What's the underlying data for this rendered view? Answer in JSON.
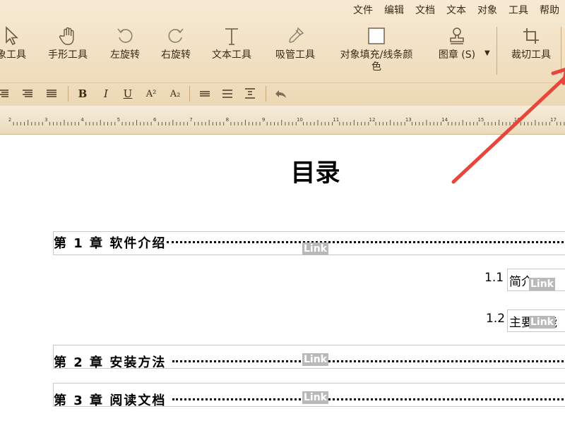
{
  "menu": [
    "文件",
    "编辑",
    "文档",
    "文本",
    "对象",
    "工具",
    "帮助"
  ],
  "tools": {
    "select": "象工具",
    "hand": "手形工具",
    "rotate_left": "左旋转",
    "rotate_right": "右旋转",
    "text": "文本工具",
    "eyedropper": "吸管工具",
    "fill_line1": "对象填充/线条颜",
    "fill_line2": "色",
    "stamp": "图章 (S)",
    "crop": "裁切工具"
  },
  "format": {
    "bold": "B",
    "italic": "I",
    "underline": "U",
    "superscript": "A²",
    "subscript": "A₂"
  },
  "ruler_labels": [
    "2",
    "3",
    "4",
    "5",
    "6",
    "7",
    "8",
    "9",
    "10",
    "11",
    "12",
    "13",
    "14",
    "15",
    "16",
    "17"
  ],
  "document": {
    "title": "目录",
    "link_label": "Link",
    "chapter1": "第 1 章 软件介绍",
    "sub1_num": "1.1",
    "sub1_text": "简介",
    "sub2_num": "1.2",
    "sub2_text": "主要功能",
    "chapter2": "第 2 章  安装方法",
    "chapter3": "第 3 章  阅读文档"
  },
  "colors": {
    "toolbar_bg": "#ecd8b4",
    "link_bg": "#b9b9b9",
    "arrow": "#e8453c"
  }
}
